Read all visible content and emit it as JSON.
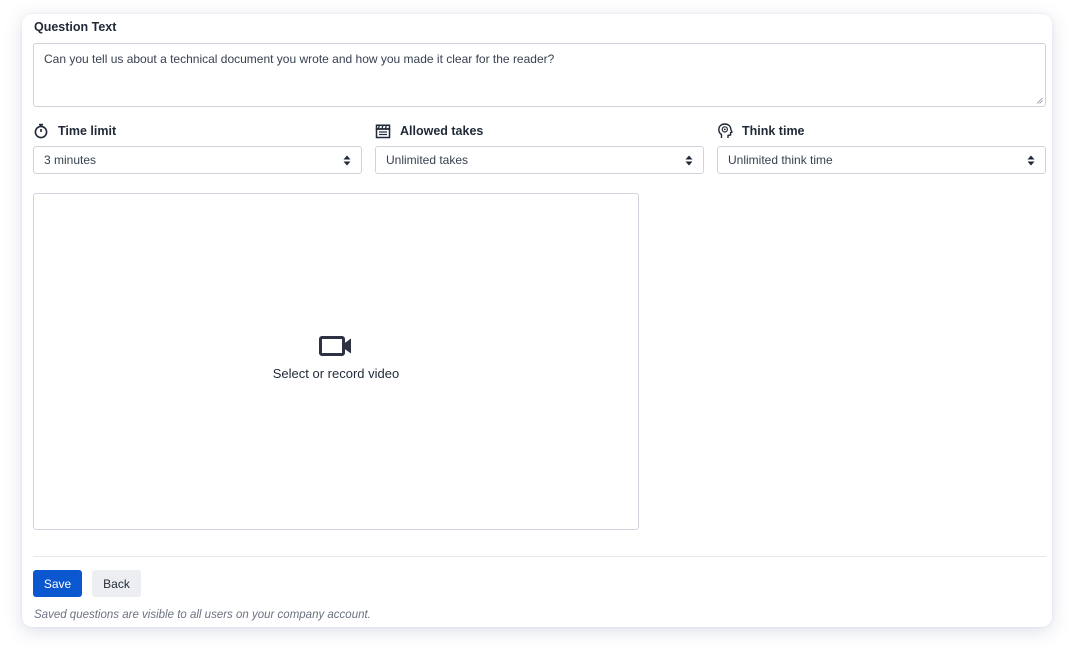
{
  "question": {
    "label": "Question Text",
    "value": "Can you tell us about a technical document you wrote and how you made it clear for the reader?"
  },
  "fields": {
    "time_limit": {
      "label": "Time limit",
      "value": "3 minutes",
      "icon": "stopwatch-icon"
    },
    "allowed_takes": {
      "label": "Allowed takes",
      "value": "Unlimited takes",
      "icon": "clapperboard-icon"
    },
    "think_time": {
      "label": "Think time",
      "value": "Unlimited think time",
      "icon": "head-brain-icon"
    }
  },
  "video": {
    "label": "Select or record video",
    "icon": "video-camera-icon"
  },
  "actions": {
    "save_label": "Save",
    "back_label": "Back"
  },
  "note": "Saved questions are visible to all users on your company account.",
  "colors": {
    "primary": "#0b57d0",
    "border": "#cfd4dc",
    "text": "#1f2937",
    "muted": "#6b7280"
  }
}
